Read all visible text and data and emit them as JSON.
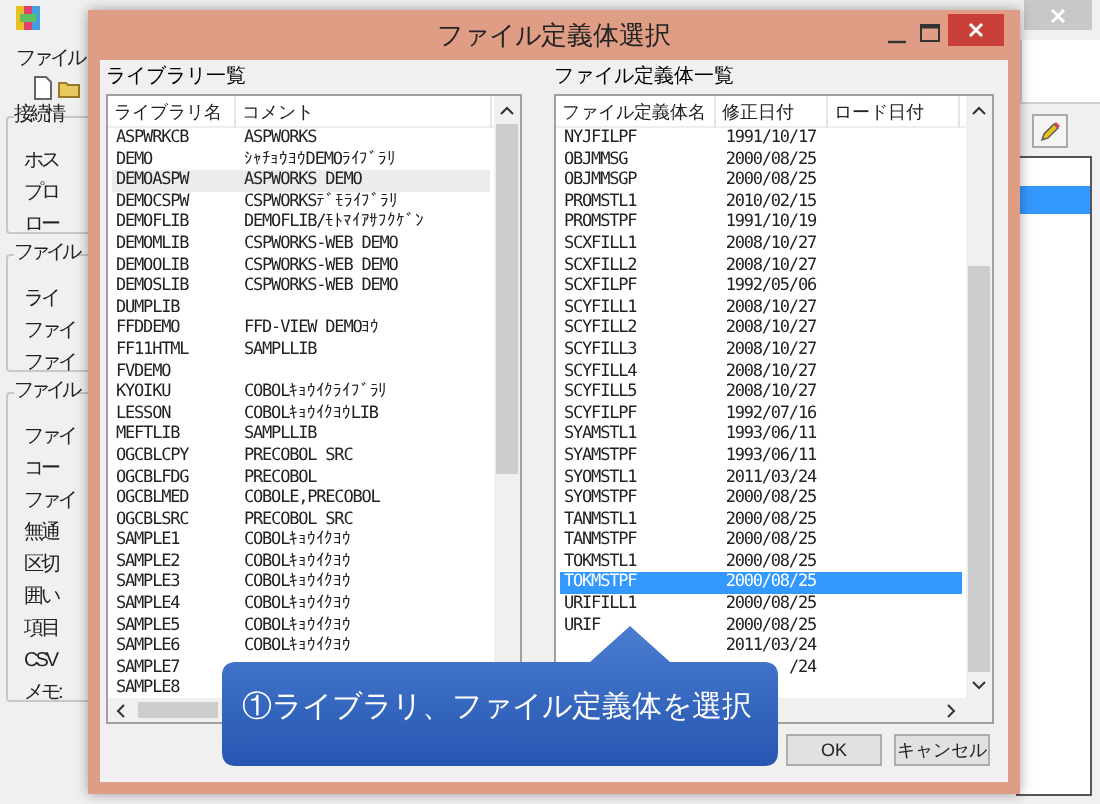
{
  "background_window": {
    "menu": [
      {
        "label": "ファイル"
      }
    ],
    "groups": [
      {
        "title": "接続情",
        "items": [
          "ホス",
          "プロ",
          "ロー"
        ]
      },
      {
        "title": "ファイル",
        "items": [
          "ライ",
          "ファイ",
          "ファイ"
        ]
      },
      {
        "title": "ファイル",
        "items": [
          "ファイ",
          "コー",
          "ファイ",
          "無通",
          "区切",
          "囲い",
          "項目",
          "CSV",
          "メモ:"
        ]
      }
    ],
    "side_list": {
      "rows": [
        {
          "selected": true
        }
      ]
    }
  },
  "dialog": {
    "title": "ファイル定義体選択",
    "library_list": {
      "label": "ライブラリ一覧",
      "columns": [
        "ライブラリ名",
        "コメント"
      ],
      "rows": [
        {
          "name": "ASPWRKCB",
          "comment": "ASPWORKS",
          "selected": false
        },
        {
          "name": "DEMO",
          "comment": "ｼｬﾁｮｳﾖｳDEMOﾗｲﾌﾞﾗﾘ",
          "selected": false
        },
        {
          "name": "DEMOASPW",
          "comment": "ASPWORKS DEMO",
          "selected": true
        },
        {
          "name": "DEMOCSPW",
          "comment": "CSPWORKSﾃﾞﾓﾗｲﾌﾞﾗﾘ",
          "selected": false
        },
        {
          "name": "DEMOFLIB",
          "comment": "DEMOFLIB/ﾓﾄﾏｲｱｻﾌｸｹﾞﾝ",
          "selected": false
        },
        {
          "name": "DEMOMLIB",
          "comment": "CSPWORKS-WEB DEMO",
          "selected": false
        },
        {
          "name": "DEMOOLIB",
          "comment": "CSPWORKS-WEB DEMO",
          "selected": false
        },
        {
          "name": "DEMOSLIB",
          "comment": "CSPWORKS-WEB DEMO",
          "selected": false
        },
        {
          "name": "DUMPLIB",
          "selected": false
        },
        {
          "name": "FFDDEMO",
          "comment": "FFD-VIEW DEMOﾖｳ",
          "selected": false
        },
        {
          "name": "FF11HTML",
          "comment": "SAMPLLIB",
          "selected": false
        },
        {
          "name": "FVDEMO",
          "selected": false
        },
        {
          "name": "KYOIKU",
          "comment": "COBOLｷｮｳｲｸﾗｲﾌﾞﾗﾘ",
          "selected": false
        },
        {
          "name": "LESSON",
          "comment": "COBOLｷｮｳｲｸﾖｳLIB",
          "selected": false
        },
        {
          "name": "MEFTLIB",
          "comment": "SAMPLLIB",
          "selected": false
        },
        {
          "name": "OGCBLCPY",
          "comment": "PRECOBOL SRC",
          "selected": false
        },
        {
          "name": "OGCBLFDG",
          "comment": "PRECOBOL",
          "selected": false
        },
        {
          "name": "OGCBLMED",
          "comment": "COBOLE,PRECOBOL",
          "selected": false
        },
        {
          "name": "OGCBLSRC",
          "comment": "PRECOBOL SRC",
          "selected": false
        },
        {
          "name": "SAMPLE1",
          "comment": "COBOLｷｮｳｲｸﾖｳ",
          "selected": false
        },
        {
          "name": "SAMPLE2",
          "comment": "COBOLｷｮｳｲｸﾖｳ",
          "selected": false
        },
        {
          "name": "SAMPLE3",
          "comment": "COBOLｷｮｳｲｸﾖｳ",
          "selected": false
        },
        {
          "name": "SAMPLE4",
          "comment": "COBOLｷｮｳｲｸﾖｳ",
          "selected": false
        },
        {
          "name": "SAMPLE5",
          "comment": "COBOLｷｮｳｲｸﾖｳ",
          "selected": false
        },
        {
          "name": "SAMPLE6",
          "comment": "COBOLｷｮｳｲｸﾖｳ",
          "selected": false
        },
        {
          "name": "SAMPLE7",
          "selected": false
        },
        {
          "name": "SAMPLE8",
          "selected": false
        }
      ]
    },
    "file_list": {
      "label": "ファイル定義体一覧",
      "columns": [
        "ファイル定義体名",
        "修正日付",
        "ロード日付"
      ],
      "rows": [
        {
          "name": "NYJFILPF",
          "modified": "1991/10/17",
          "selected": false
        },
        {
          "name": "OBJMMSG",
          "modified": "2000/08/25",
          "selected": false
        },
        {
          "name": "OBJMMSGP",
          "modified": "2000/08/25",
          "selected": false
        },
        {
          "name": "PROMSTL1",
          "modified": "2010/02/15",
          "selected": false
        },
        {
          "name": "PROMSTPF",
          "modified": "1991/10/19",
          "selected": false
        },
        {
          "name": "SCXFILL1",
          "modified": "2008/10/27",
          "selected": false
        },
        {
          "name": "SCXFILL2",
          "modified": "2008/10/27",
          "selected": false
        },
        {
          "name": "SCXFILPF",
          "modified": "1992/05/06",
          "selected": false
        },
        {
          "name": "SCYFILL1",
          "modified": "2008/10/27",
          "selected": false
        },
        {
          "name": "SCYFILL2",
          "modified": "2008/10/27",
          "selected": false
        },
        {
          "name": "SCYFILL3",
          "modified": "2008/10/27",
          "selected": false
        },
        {
          "name": "SCYFILL4",
          "modified": "2008/10/27",
          "selected": false
        },
        {
          "name": "SCYFILL5",
          "modified": "2008/10/27",
          "selected": false
        },
        {
          "name": "SCYFILPF",
          "modified": "1992/07/16",
          "selected": false
        },
        {
          "name": "SYAMSTL1",
          "modified": "1993/06/11",
          "selected": false
        },
        {
          "name": "SYAMSTPF",
          "modified": "1993/06/11",
          "selected": false
        },
        {
          "name": "SYOMSTL1",
          "modified": "2011/03/24",
          "selected": false
        },
        {
          "name": "SYOMSTPF",
          "modified": "2000/08/25",
          "selected": false
        },
        {
          "name": "TANMSTL1",
          "modified": "2000/08/25",
          "selected": false
        },
        {
          "name": "TANMSTPF",
          "modified": "2000/08/25",
          "selected": false
        },
        {
          "name": "TOKMSTL1",
          "modified": "2000/08/25",
          "selected": false
        },
        {
          "name": "TOKMSTPF",
          "modified": "2000/08/25",
          "selected": true
        },
        {
          "name": "URIFILL1",
          "modified": "2000/08/25",
          "selected": false
        },
        {
          "name": "URIF",
          "modified": "2000/08/25",
          "selected": false
        },
        {
          "modified": "2011/03/24",
          "selected": false
        },
        {
          "modified": "/24",
          "selected": false
        }
      ]
    },
    "buttons": [
      {
        "label": "OK"
      },
      {
        "label": "キャンセル"
      }
    ]
  },
  "callout": {
    "text": "①ライブラリ、ファイル定義体を選択"
  }
}
